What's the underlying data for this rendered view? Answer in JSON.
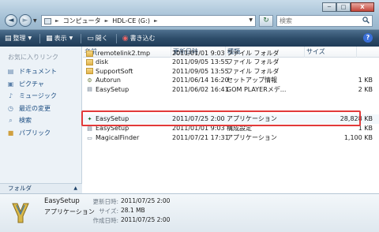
{
  "window": {
    "minimize": "─",
    "maximize": "□",
    "close": "X"
  },
  "nav": {
    "back": "◄",
    "forward": "►",
    "dropdown": "▼"
  },
  "address": {
    "crumbs": [
      "コンピュータ",
      "HDL-CE (G:)"
    ],
    "separator": "►",
    "dropdown": "▼"
  },
  "refresh_glyph": "↻",
  "search": {
    "placeholder": "検索",
    "icon": "magnifier-icon"
  },
  "toolbar": {
    "organize": "整理",
    "view": "表示",
    "open": "開く",
    "burn": "書き込む",
    "help": "?"
  },
  "sidebar": {
    "title": "お気に入りリンク",
    "items": [
      {
        "label": "ドキュメント",
        "icon": "document-icon"
      },
      {
        "label": "ピクチャ",
        "icon": "picture-icon"
      },
      {
        "label": "ミュージック",
        "icon": "music-icon"
      },
      {
        "label": "最近の変更",
        "icon": "recent-icon"
      },
      {
        "label": "検索",
        "icon": "search-icon"
      },
      {
        "label": "パブリック",
        "icon": "public-folder-icon"
      }
    ],
    "folders_label": "フォルダ"
  },
  "columns": {
    "name": "名前",
    "date": "更新日時",
    "type": "種類",
    "size": "サイズ"
  },
  "files": [
    {
      "name": ".remotelink2.tmp",
      "date": "2011/01/01 9:03",
      "type": "ファイル フォルダ",
      "size": "",
      "icon": "folder"
    },
    {
      "name": "disk",
      "date": "2011/09/05 13:55",
      "type": "ファイル フォルダ",
      "size": "",
      "icon": "folder"
    },
    {
      "name": "SupportSoft",
      "date": "2011/09/05 13:55",
      "type": "ファイル フォルダ",
      "size": "",
      "icon": "folder"
    },
    {
      "name": "Autorun",
      "date": "2011/06/14 16:20",
      "type": "セットアップ情報",
      "size": "1 KB",
      "icon": "auto"
    },
    {
      "name": "EasySetup",
      "date": "2011/06/02 16:41",
      "type": "GOM PLAYERメデ...",
      "size": "2 KB",
      "icon": "doc"
    },
    {
      "name": "EasySetup",
      "date": "2011/07/25 2:00",
      "type": "アプリケーション",
      "size": "28,828 KB",
      "icon": "app"
    },
    {
      "name": "EasySetup",
      "date": "2011/01/01 9:03",
      "type": "構成設定",
      "size": "1 KB",
      "icon": "doc"
    },
    {
      "name": "MagicalFinder",
      "date": "2011/07/21 17:31",
      "type": "アプリケーション",
      "size": "1,100 KB",
      "icon": "app"
    }
  ],
  "selected_index": 5,
  "details": {
    "name": "EasySetup",
    "type": "アプリケーション",
    "modified_label": "更新日時:",
    "modified_value": "2011/07/25 2:00",
    "size_label": "サイズ:",
    "size_value": "28.1 MB",
    "created_label": "作成日時:",
    "created_value": "2011/07/25 2:00"
  },
  "colors": {
    "highlight": "#e23a3a",
    "toolbar": "#2e4d6a",
    "link": "#1b4d82"
  }
}
